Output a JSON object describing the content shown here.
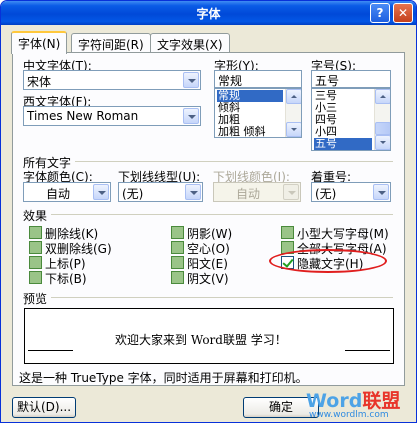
{
  "window": {
    "title": "字体"
  },
  "titlebar": {
    "help_icon": "?",
    "close_icon": "✕"
  },
  "tabs": [
    {
      "label": "字体(N)",
      "active": true
    },
    {
      "label": "字符间距(R)",
      "active": false
    },
    {
      "label": "文字效果(X)",
      "active": false
    }
  ],
  "font": {
    "chinese_label": "中文字体(T):",
    "chinese_value": "宋体",
    "western_label": "西文字体(F):",
    "western_value": "Times New Roman",
    "style_label": "字形(Y):",
    "style_value": "常规",
    "style_options": [
      "常规",
      "倾斜",
      "加粗",
      "加粗 倾斜"
    ],
    "style_selected": "常规",
    "size_label": "字号(S):",
    "size_value": "五号",
    "size_options": [
      "三号",
      "小三",
      "四号",
      "小四",
      "五号"
    ],
    "size_selected": "五号"
  },
  "all_text": {
    "section_label": "所有文字",
    "color_label": "字体颜色(C):",
    "color_value": "自动",
    "underline_label": "下划线线型(U):",
    "underline_value": "(无)",
    "underline_color_label": "下划线颜色(I):",
    "underline_color_value": "自动",
    "emphasis_label": "着重号:",
    "emphasis_value": "(无)"
  },
  "effects": {
    "section_label": "效果",
    "items": [
      {
        "label": "删除线(K)",
        "checked": false
      },
      {
        "label": "双删除线(G)",
        "checked": false
      },
      {
        "label": "上标(P)",
        "checked": false
      },
      {
        "label": "下标(B)",
        "checked": false
      },
      {
        "label": "阴影(W)",
        "checked": false
      },
      {
        "label": "空心(O)",
        "checked": false
      },
      {
        "label": "阳文(E)",
        "checked": false
      },
      {
        "label": "阴文(V)",
        "checked": false
      },
      {
        "label": "小型大写字母(M)",
        "checked": false
      },
      {
        "label": "全部大写字母(A)",
        "checked": false
      },
      {
        "label": "隐藏文字(H)",
        "checked": true
      }
    ]
  },
  "preview": {
    "section_label": "预览",
    "text": "欢迎大家来到 Word联盟 学习！"
  },
  "status_text": "这是一种 TrueType 字体，同时适用于屏幕和打印机。",
  "buttons": {
    "default_label": "默认(D)...",
    "ok_label": "确定"
  },
  "watermark": {
    "word": "Word",
    "cn": "联盟",
    "url": "www.wordlm.com"
  },
  "colors": {
    "highlight": "#316ac5",
    "annotation": "#e01e1e",
    "titlebar": "#0049d8"
  }
}
